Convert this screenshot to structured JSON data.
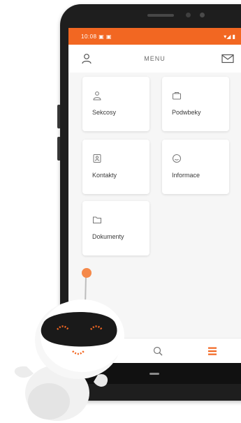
{
  "status_bar": {
    "left_text": "10:08 ▣ ▣",
    "right_text": "▾◢ ▮",
    "color": "#f26722"
  },
  "header": {
    "title": "MENU",
    "left_icon": "user-icon",
    "right_icon": "mail-icon"
  },
  "menu": {
    "items": [
      {
        "label": "Sekcosy",
        "icon": "people-icon"
      },
      {
        "label": "Podwbeky",
        "icon": "person-icon"
      },
      {
        "label": "Kontakty",
        "icon": "contact-card-icon"
      },
      {
        "label": "Informace",
        "icon": "info-icon"
      },
      {
        "label": "Dokumenty",
        "icon": "folder-icon"
      }
    ]
  },
  "bottom_nav": {
    "items": [
      {
        "icon": "search-icon"
      },
      {
        "icon": "menu-icon",
        "active": true
      }
    ]
  },
  "colors": {
    "accent": "#f26722",
    "background": "#f6f6f6",
    "tile": "#ffffff",
    "phone_frame": "#1e1e1e"
  }
}
